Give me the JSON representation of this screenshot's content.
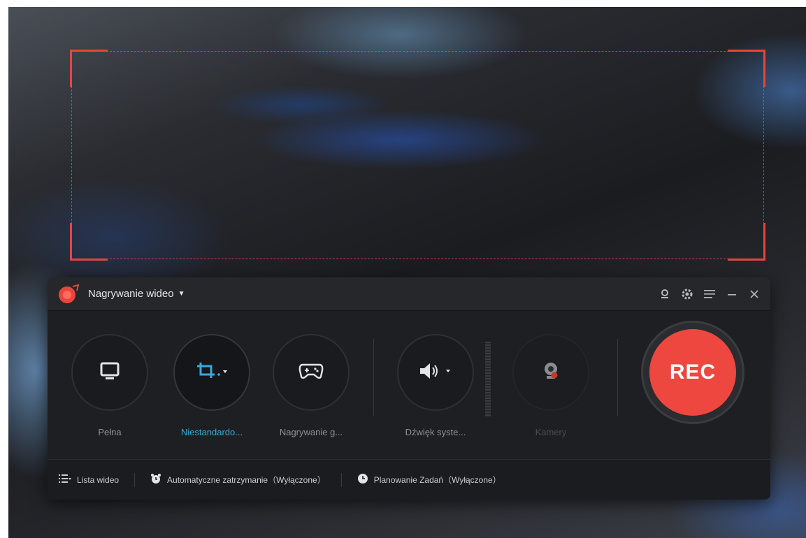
{
  "titlebar": {
    "mode_label": "Nagrywanie wideo",
    "tools": [
      "webcam-icon",
      "gear-icon",
      "menu-icon",
      "minimize-icon",
      "close-icon"
    ]
  },
  "modes": [
    {
      "id": "full",
      "label": "Pełna",
      "icon": "monitor-icon",
      "state": "normal"
    },
    {
      "id": "custom",
      "label": "Niestandardo...",
      "icon": "crop-icon",
      "state": "active"
    },
    {
      "id": "game",
      "label": "Nagrywanie g...",
      "icon": "gamepad-icon",
      "state": "normal"
    },
    {
      "id": "audio",
      "label": "Dźwięk syste...",
      "icon": "speaker-icon",
      "state": "normal"
    },
    {
      "id": "camera",
      "label": "Kamery",
      "icon": "camera-off-icon",
      "state": "disabled"
    }
  ],
  "rec_button": {
    "label": "REC",
    "color": "#ee4740"
  },
  "bottombar": {
    "video_list": "Lista wideo",
    "auto_stop": "Automatyczne zatrzymanie（Wyłączone）",
    "schedule": "Planowanie Zadań（Wyłączone）"
  },
  "colors": {
    "accent": "#3aa8d8",
    "record": "#ee4740",
    "frame": "#e8453c"
  }
}
